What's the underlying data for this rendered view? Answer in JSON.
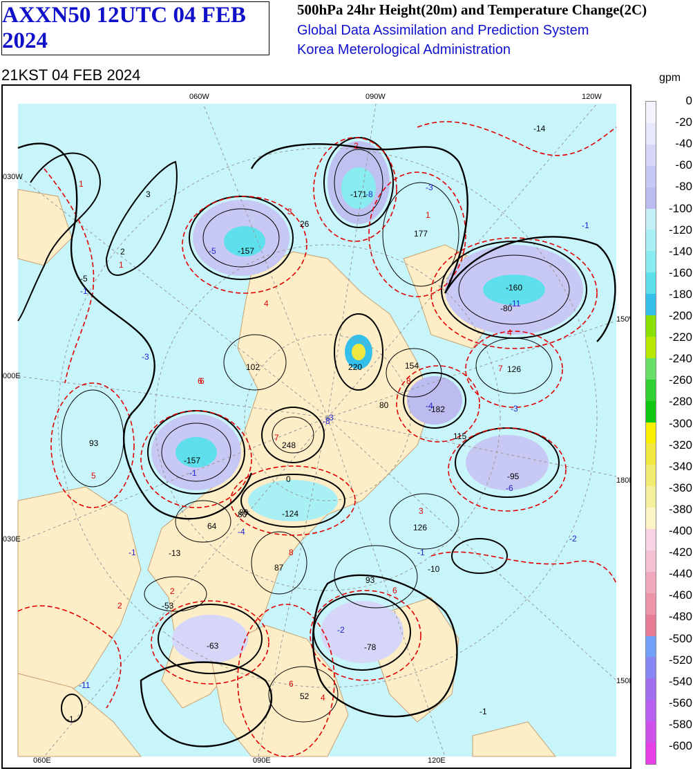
{
  "header": {
    "product_id": "AXXN50 12UTC 04 FEB 2024",
    "title": "500hPa 24hr Height(20m) and Temperature Change(2C)",
    "system": "Global Data Assimilation and Prediction System",
    "agency": "Korea Meterological Administration",
    "valid_time": "21KST 04 FEB 2024"
  },
  "map": {
    "top_labels": [
      "060W",
      "090W",
      "120W"
    ],
    "bottom_labels": [
      "060E",
      "090E",
      "120E"
    ],
    "left_labels": [
      "030W",
      "000E",
      "030E"
    ],
    "right_labels": [
      "150W",
      "180E",
      "150E"
    ],
    "height_centers": [
      "-171",
      "177",
      "-160",
      "-157",
      "102",
      "154",
      "-14",
      "3",
      "2",
      "26",
      "-5",
      "220",
      "80",
      "-182",
      "126",
      "115",
      "248",
      "-157",
      "93",
      "-95",
      "-124",
      "64",
      "126",
      "80",
      "-13",
      "87",
      "93",
      "-10",
      "-53",
      "-63",
      "-78",
      "52",
      "-1",
      "-1"
    ],
    "temp_labels_blue": [
      "-8",
      "-3",
      "-1",
      "-5",
      "-1",
      "-3",
      "-11",
      "-3",
      "-4",
      "-3",
      "-8",
      "-6",
      "-4",
      "-1",
      "-2",
      "-1",
      "-2",
      "-11",
      "-1"
    ],
    "temp_labels_red": [
      "2",
      "1",
      "1",
      "3",
      "4",
      "6",
      "7",
      "8",
      "5",
      "7",
      "4",
      "6",
      "3",
      "2",
      "2",
      "6",
      "8",
      "6",
      "1",
      "4"
    ],
    "contour_labels": [
      "0",
      "-80",
      "80"
    ],
    "colors": {
      "ocean": "#c8f5fa",
      "land": "#fdeec8",
      "coast": "#c8a070",
      "height_contour": "#000000",
      "temp_contour": "#e00000"
    }
  },
  "legend": {
    "unit": "gpm",
    "ticks": [
      "0",
      "-20",
      "-40",
      "-60",
      "-80",
      "-100",
      "-120",
      "-140",
      "-160",
      "-180",
      "-200",
      "-220",
      "-240",
      "-260",
      "-280",
      "-300",
      "-320",
      "-340",
      "-360",
      "-380",
      "-400",
      "-420",
      "-440",
      "-460",
      "-480",
      "-500",
      "-520",
      "-540",
      "-560",
      "-580",
      "-600"
    ],
    "colors": [
      "#f4f4ff",
      "#e8e8fc",
      "#d6d6f8",
      "#c8c8f4",
      "#bcbcf0",
      "#c4f0f6",
      "#a8f0f4",
      "#88ecf0",
      "#5ee0ec",
      "#34c0ea",
      "#8ae000",
      "#b8e800",
      "#66e066",
      "#30d030",
      "#10c810",
      "#f8f000",
      "#f0e840",
      "#f0ec70",
      "#f4f09c",
      "#fdf4c8",
      "#f8d4e4",
      "#f4c0d4",
      "#f0a8bc",
      "#ec94a8",
      "#e87c94",
      "#70a0f8",
      "#8888f4",
      "#a070f0",
      "#b860f0",
      "#d050ec",
      "#e840e8"
    ]
  }
}
